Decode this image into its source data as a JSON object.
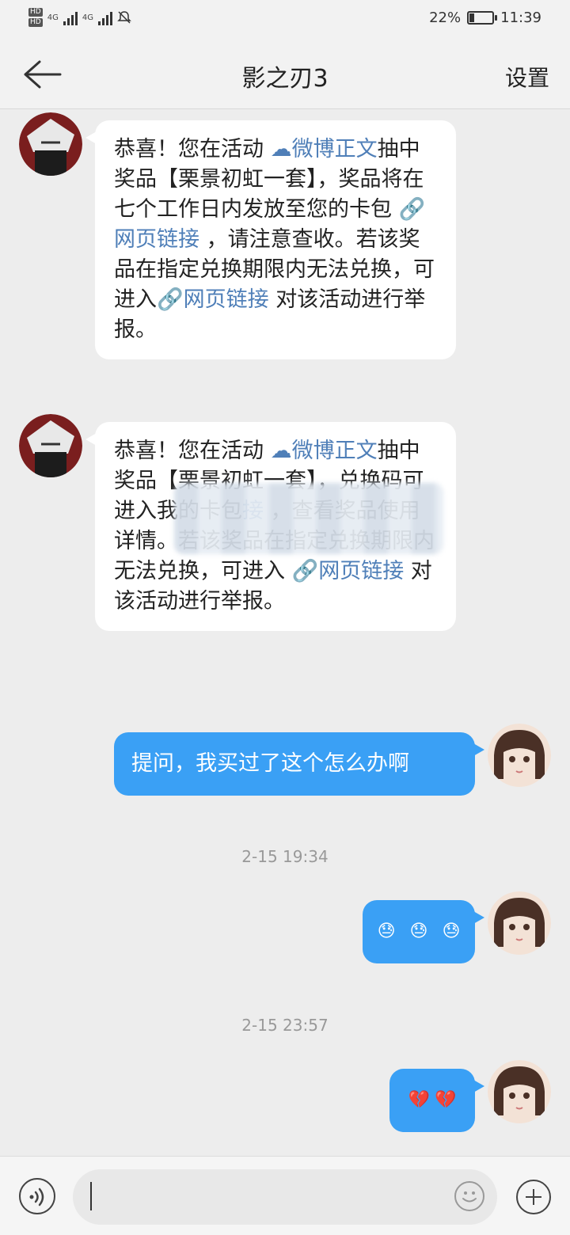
{
  "status_bar": {
    "hd_1": "HD",
    "hd_2": "HD",
    "net_1": "4G",
    "net_2": "4G",
    "battery": "22%",
    "battery_level": 0.22,
    "time": "11:39"
  },
  "header": {
    "title": "影之刃3",
    "settings_label": "设置"
  },
  "messages": [
    {
      "sender": "other",
      "parts": [
        {
          "text": "恭喜！您在活动 "
        },
        {
          "text": "微博正文",
          "link": true,
          "icon": "weibo-icon"
        },
        {
          "text": "抽中奖品【栗景初虹一套】，奖品将在七个工作日内发放至您的卡包 "
        },
        {
          "text": "网页链接",
          "link": true,
          "icon": "link-icon"
        },
        {
          "text": " ，请注意查收。若该奖品在指定兑换期限内无法兑换，可进入"
        },
        {
          "text": "网页链接",
          "link": true,
          "icon": "link-icon"
        },
        {
          "text": "  对该活动进行举报。"
        }
      ]
    },
    {
      "sender": "other",
      "parts": [
        {
          "text": "恭喜！您在活动 "
        },
        {
          "text": "微博正文",
          "link": true,
          "icon": "weibo-icon"
        },
        {
          "text": "抽中奖品【栗景初虹一套】，兑换码"
        },
        {
          "text": "可进入我的卡包"
        },
        {
          "text": "接",
          "link": true
        },
        {
          "text": " ，查看奖品使用详情。若该奖品在指定兑换期限内无法兑换，可进入 "
        },
        {
          "text": "网页链接",
          "link": true,
          "icon": "link-icon"
        },
        {
          "text": "  对该活动进行举报。"
        }
      ]
    },
    {
      "sender": "me",
      "text": "提问，我买过了这个怎么办啊"
    },
    {
      "sender": "timestamp",
      "text": "2-15 19:34"
    },
    {
      "sender": "me",
      "emoji": [
        "😓",
        "😓",
        "😓"
      ]
    },
    {
      "sender": "timestamp",
      "text": "2-15 23:57"
    },
    {
      "sender": "me",
      "emoji": [
        "💔",
        "💔"
      ]
    }
  ],
  "colors": {
    "accent": "#3aa0f5",
    "link": "#4f7fb8",
    "background": "#ededed"
  }
}
